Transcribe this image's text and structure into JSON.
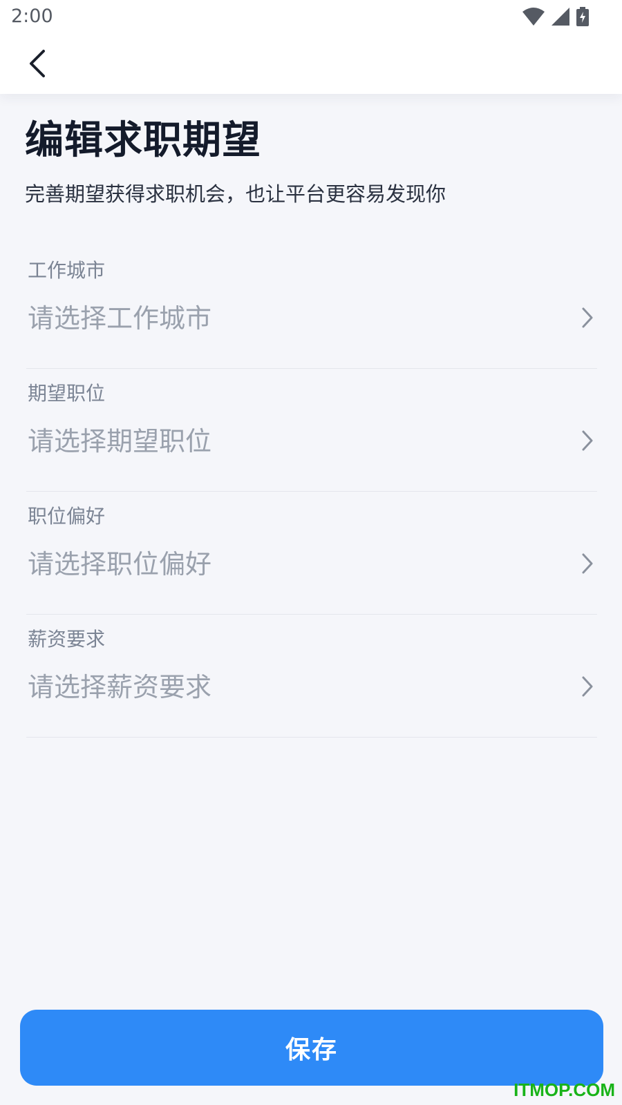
{
  "status_bar": {
    "time": "2:00",
    "icons": [
      "wifi-icon",
      "signal-icon",
      "battery-charging-icon"
    ]
  },
  "header": {
    "back_icon": "chevron-left-icon",
    "title": "编辑求职期望",
    "subtitle": "完善期望获得求职机会，也让平台更容易发现你"
  },
  "form": {
    "fields": [
      {
        "label": "工作城市",
        "placeholder": "请选择工作城市"
      },
      {
        "label": "期望职位",
        "placeholder": "请选择期望职位"
      },
      {
        "label": "职位偏好",
        "placeholder": "请选择职位偏好"
      },
      {
        "label": "薪资要求",
        "placeholder": "请选择薪资要求"
      }
    ]
  },
  "actions": {
    "save_label": "保存"
  },
  "watermark": "ITMOP.COM",
  "colors": {
    "primary": "#2e8af7",
    "background": "#f5f6fa",
    "title": "#141b2b",
    "placeholder": "#9aa1ad"
  }
}
